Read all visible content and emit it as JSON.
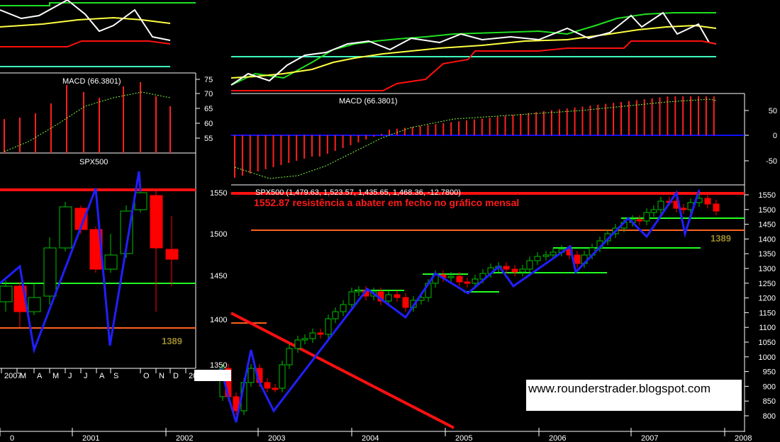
{
  "chart_data": [
    {
      "type": "line",
      "panel": "left-oscillator",
      "series": [],
      "x": [],
      "notes": "unlabeled oscillator panel (white, yellow, green, red lines)"
    },
    {
      "type": "bar",
      "panel": "left-macd",
      "title": "MACD (66.3801)",
      "ytick_labels": [
        "75",
        "70",
        "65",
        "60",
        "55"
      ],
      "ylim": [
        52,
        76
      ]
    },
    {
      "type": "candlestick",
      "panel": "left-price",
      "title": "SPX500",
      "x_tick_labels": [
        "2007",
        "M",
        "A",
        "M",
        "J",
        "J",
        "A",
        "S",
        "O",
        "N",
        "D",
        "20"
      ],
      "level_label": "1389"
    },
    {
      "type": "bar",
      "panel": "right-macd",
      "title": "MACD (66.3801)",
      "ytick_labels": [
        "50",
        "0",
        "-50"
      ],
      "ylim": [
        -75,
        100
      ]
    },
    {
      "type": "candlestick",
      "panel": "right-price",
      "title": "SPX500 (1,479.63, 1,523.57, 1,435.65, 1,468.36, -12.7800)",
      "annotation": "1552.87 resistência a abater em fecho no gráfico mensal",
      "level_label": "1389",
      "left_ytick_labels": [
        "1550",
        "1500",
        "1450",
        "1400",
        "1350"
      ],
      "right_ytick_labels": [
        "1550",
        "1500",
        "1450",
        "1400",
        "1350",
        "1300",
        "1250",
        "1200",
        "1150",
        "1100",
        "1050",
        "1000",
        "950",
        "900",
        "850",
        "800"
      ],
      "x_tick_labels": [
        "0",
        "2001",
        "2002",
        "2003",
        "2004",
        "2005",
        "2006",
        "2007",
        "2008"
      ],
      "ylim_right": [
        760,
        1580
      ]
    }
  ],
  "watermark": "www.rounderstrader.blogspot.com",
  "colors": {
    "background": "#000000",
    "up": "#00c000",
    "down": "#ff0000",
    "trend": "#2020ff",
    "support": "#22ff22",
    "resistance": "#ff0000",
    "level": "#ff6020",
    "oscillator_white": "#ffffff",
    "oscillator_yellow": "#ffff40",
    "oscillator_green": "#20e020",
    "oscillator_red": "#ff1010"
  }
}
